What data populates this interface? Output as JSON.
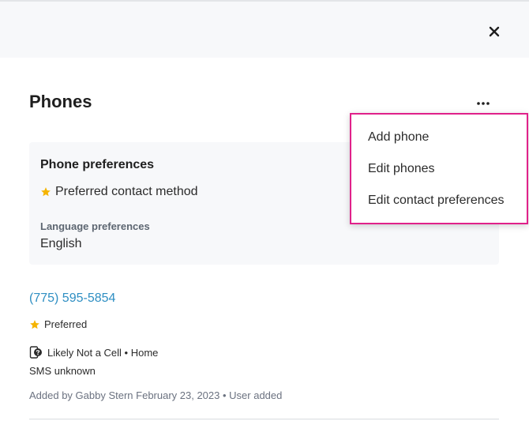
{
  "header": {
    "close_icon": "close-icon"
  },
  "panel": {
    "title": "Phones",
    "more_icon": "more-horizontal-icon"
  },
  "preferences": {
    "title": "Phone preferences",
    "preferred_method": "Preferred contact method",
    "language_label": "Language preferences",
    "language_value": "English"
  },
  "phone": {
    "number": "(775) 595-5854",
    "preferred_label": "Preferred",
    "line_type": "Likely Not a Cell • Home",
    "sms_status": "SMS unknown",
    "added_info": "Added by Gabby Stern February 23, 2023 • User added"
  },
  "menu": {
    "items": [
      "Add phone",
      "Edit phones",
      "Edit contact preferences"
    ]
  },
  "colors": {
    "star": "#f5b400",
    "link": "#2f8fc3",
    "menu_highlight_border": "#e0218a"
  }
}
